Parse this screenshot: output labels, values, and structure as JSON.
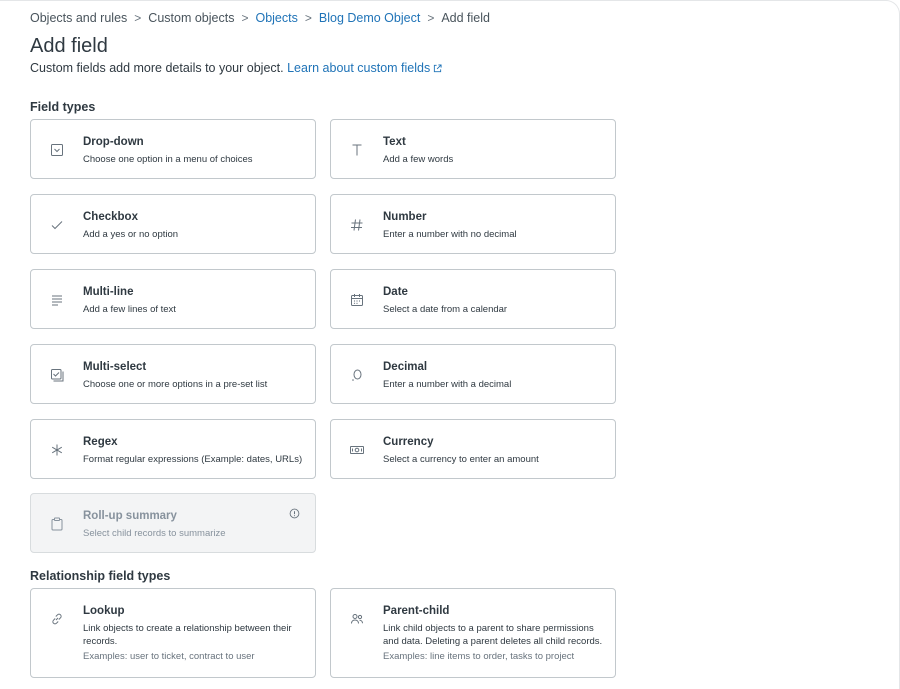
{
  "breadcrumb": {
    "items": [
      "Objects and rules",
      "Custom objects",
      "Objects",
      "Blog Demo Object",
      "Add field"
    ],
    "separator": ">"
  },
  "page": {
    "title": "Add field",
    "subtitle": "Custom fields add more details to your object.",
    "learn_link": "Learn about custom fields"
  },
  "field_types": {
    "title": "Field types",
    "cards": [
      {
        "name": "Drop-down",
        "desc": "Choose one option in a menu of choices",
        "icon": "dropdown-icon"
      },
      {
        "name": "Text",
        "desc": "Add a few words",
        "icon": "text-icon"
      },
      {
        "name": "Checkbox",
        "desc": "Add a yes or no option",
        "icon": "checkmark-icon"
      },
      {
        "name": "Number",
        "desc": "Enter a number with no decimal",
        "icon": "hash-icon"
      },
      {
        "name": "Multi-line",
        "desc": "Add a few lines of text",
        "icon": "lines-icon"
      },
      {
        "name": "Date",
        "desc": "Select a date from a calendar",
        "icon": "calendar-icon"
      },
      {
        "name": "Multi-select",
        "desc": "Choose one or more options in a pre-set list",
        "icon": "multiselect-icon"
      },
      {
        "name": "Decimal",
        "desc": "Enter a number with a decimal",
        "icon": "decimal-icon"
      },
      {
        "name": "Regex",
        "desc": "Format regular expressions (Example: dates, URLs)",
        "icon": "asterisk-icon"
      },
      {
        "name": "Currency",
        "desc": "Select a currency to enter an amount",
        "icon": "banknote-icon"
      },
      {
        "name": "Roll-up summary",
        "desc": "Select child records to summarize",
        "icon": "clipboard-icon",
        "disabled": true
      }
    ]
  },
  "relationship_types": {
    "title": "Relationship field types",
    "cards": [
      {
        "name": "Lookup",
        "desc": "Link objects to create a relationship between their records.",
        "example": "Examples: user to ticket, contract to user",
        "icon": "link-icon"
      },
      {
        "name": "Parent-child",
        "desc": "Link child objects to a parent to share permissions and data. Deleting a parent deletes all child records.",
        "example": "Examples: line items to order, tasks to project",
        "icon": "users-icon"
      }
    ]
  },
  "colors": {
    "link": "#1f73b7",
    "text": "#2f3941",
    "border": "#c2c8cc",
    "disabled_bg": "#f3f4f5",
    "icon": "#68737d"
  }
}
